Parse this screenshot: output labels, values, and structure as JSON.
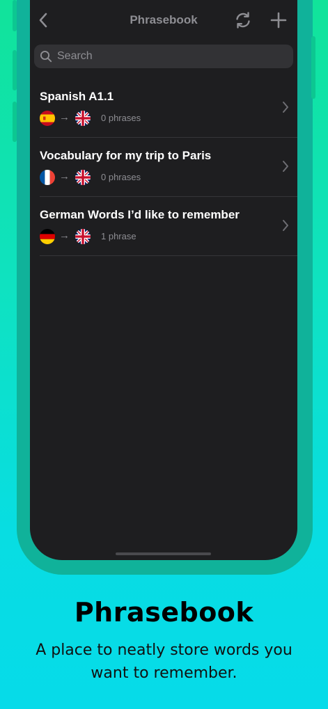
{
  "nav": {
    "title": "Phrasebook",
    "back_icon": "chevron-left-icon",
    "sync_icon": "sync-icon",
    "add_icon": "plus-icon"
  },
  "search": {
    "placeholder": "Search",
    "value": ""
  },
  "phrasebooks": [
    {
      "title": "Spanish A1.1",
      "source_flag": "spain-flag-icon",
      "target_flag": "uk-flag-icon",
      "arrow": "→",
      "count": "0 phrases"
    },
    {
      "title": "Vocabulary for my trip to Paris",
      "source_flag": "france-flag-icon",
      "target_flag": "uk-flag-icon",
      "arrow": "→",
      "count": "0 phrases"
    },
    {
      "title": "German Words I’d like to remember",
      "source_flag": "germany-flag-icon",
      "target_flag": "uk-flag-icon",
      "arrow": "→",
      "count": "1 phrase"
    }
  ],
  "promo": {
    "title": "Phrasebook",
    "subtitle": "A place to neatly store words you want to remember."
  },
  "colors": {
    "background_top": "#11e39a",
    "background_bottom": "#06dbe9",
    "screen": "#1e1e20",
    "search_field": "#323235",
    "secondary_text": "#8e8e93"
  }
}
